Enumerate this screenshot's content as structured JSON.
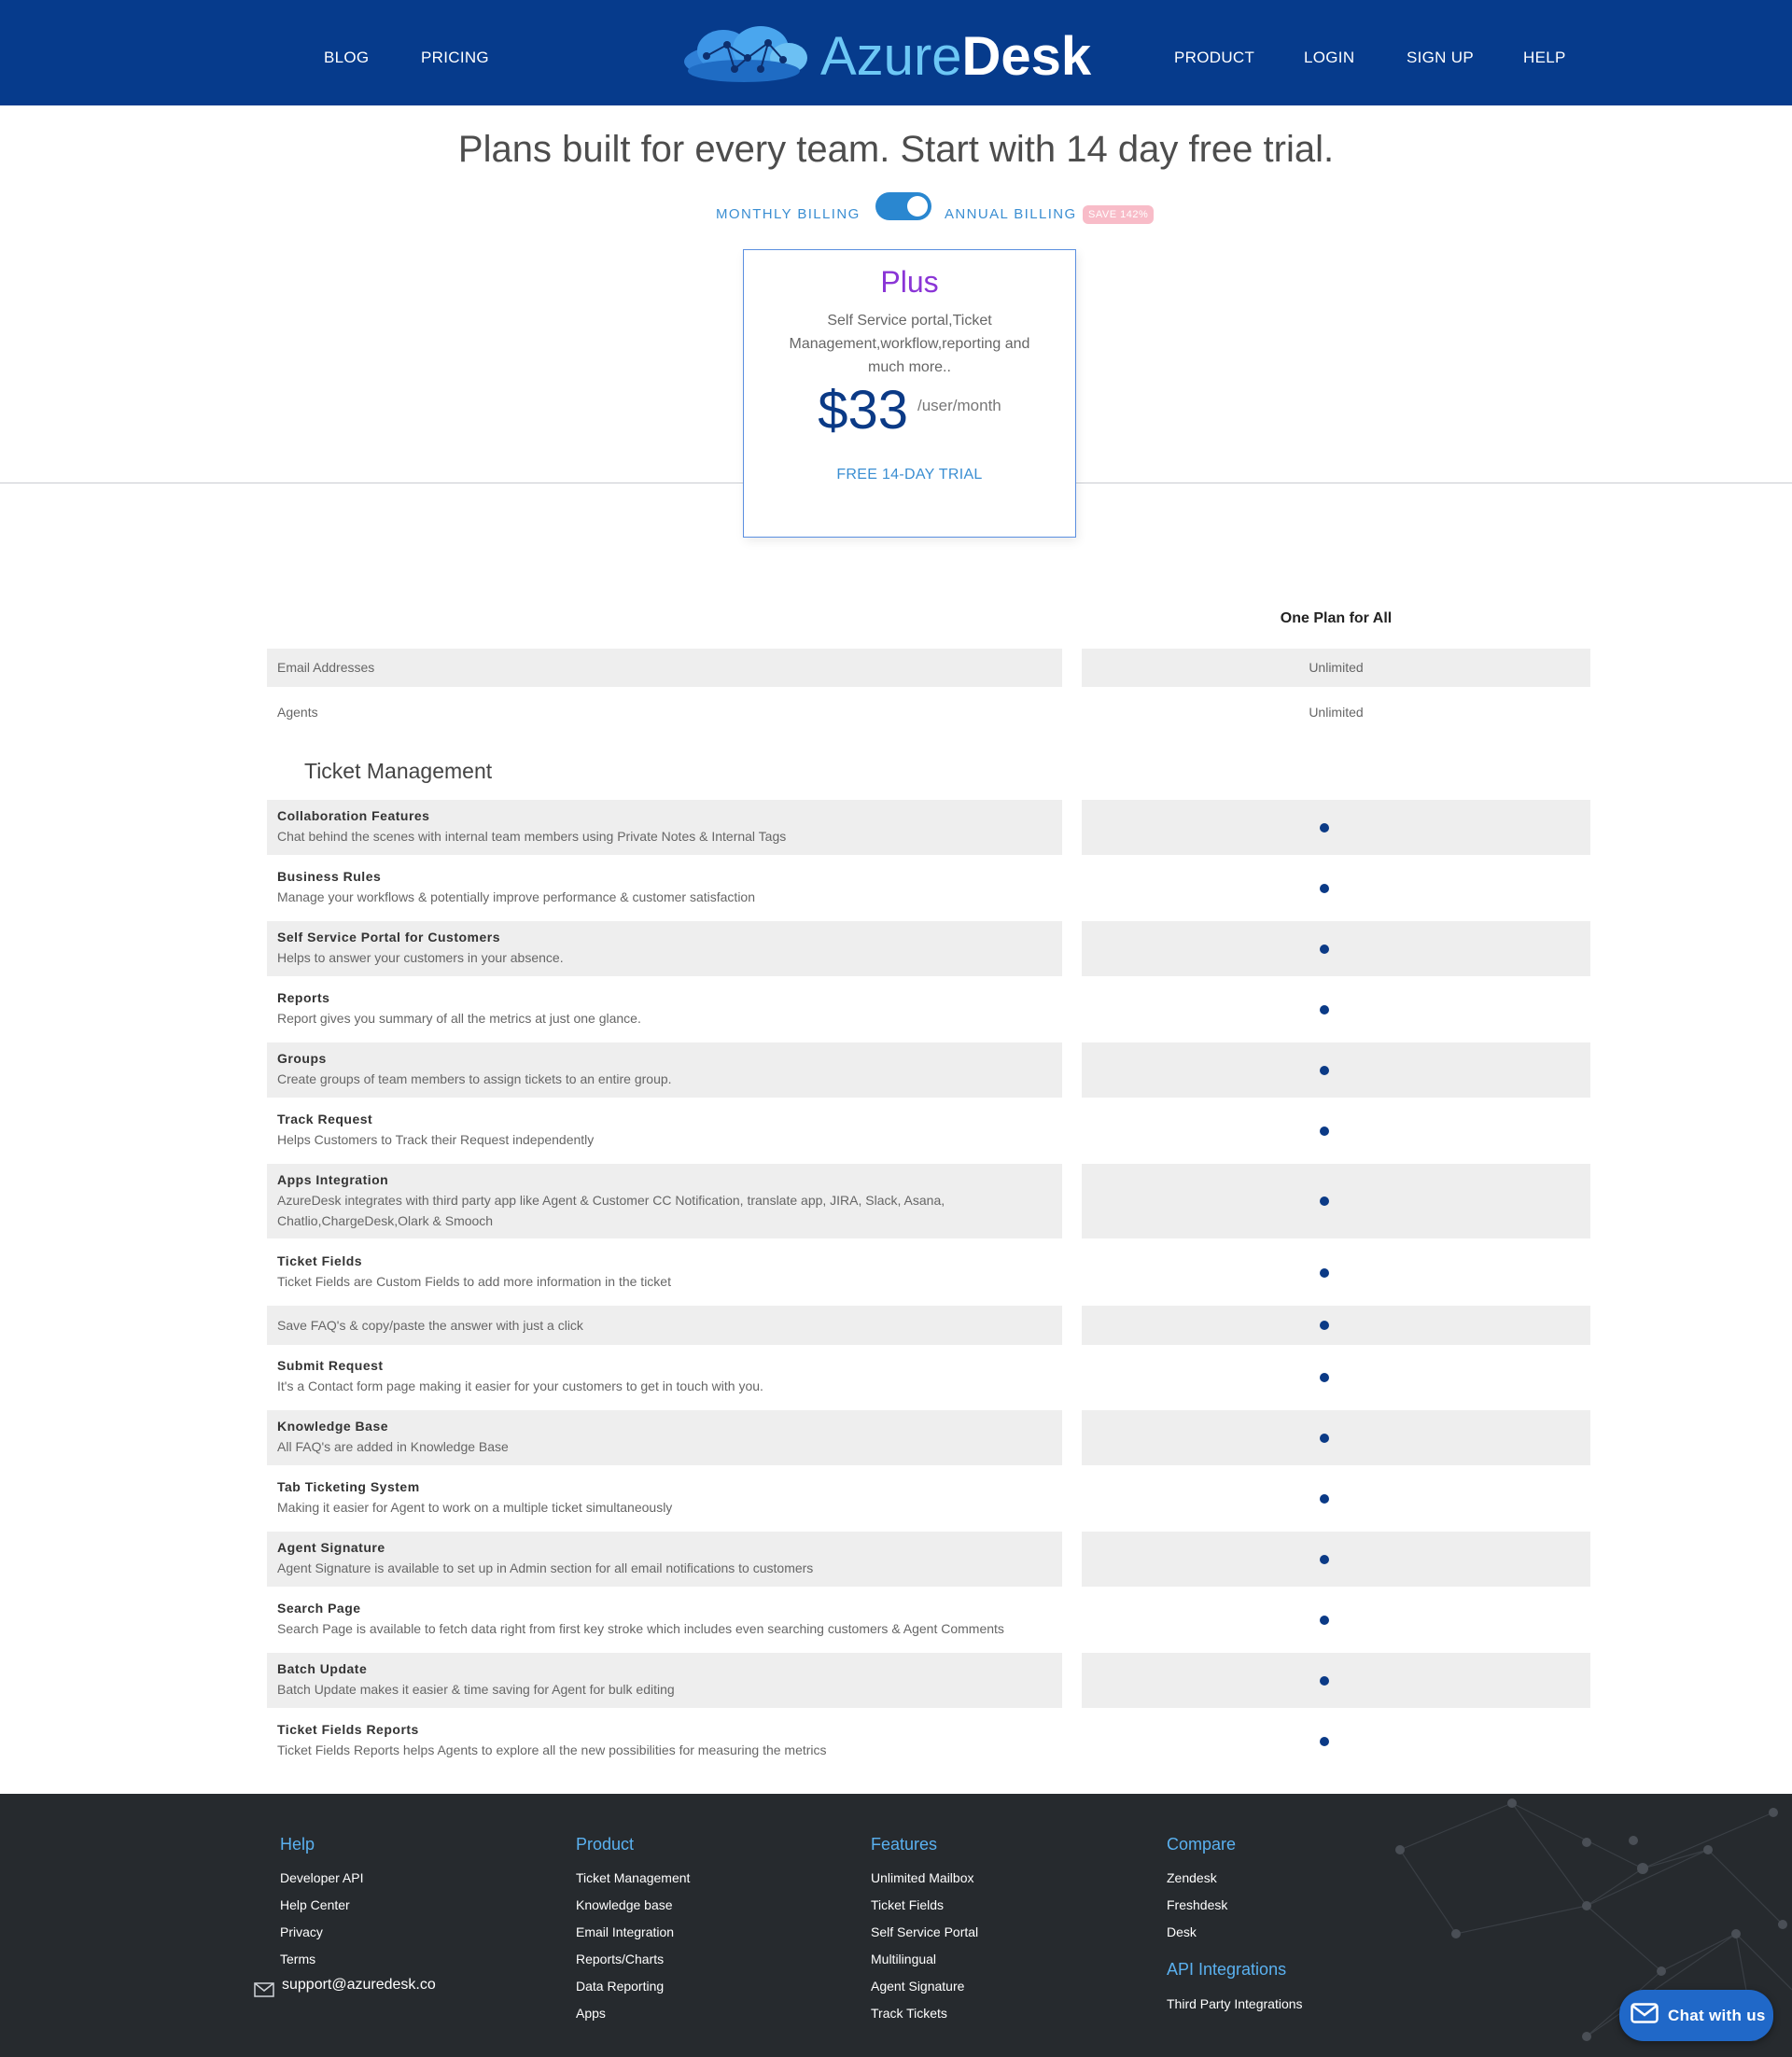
{
  "header": {
    "nav_left": [
      "BLOG",
      "PRICING"
    ],
    "logo": {
      "part1": "Azure",
      "part2": "Desk"
    },
    "nav_right": [
      "PRODUCT",
      "LOGIN",
      "SIGN UP",
      "HELP"
    ]
  },
  "hero": {
    "title": "Plans built for every team. Start with 14 day free trial.",
    "monthly_label": "MONTHLY BILLING",
    "annual_label": "ANNUAL BILLING",
    "save_badge": "SAVE 142%",
    "toggle_state": "annual"
  },
  "plan": {
    "name": "Plus",
    "description": "Self Service portal,Ticket Management,workflow,reporting and much more..",
    "price": "$33",
    "unit": "/user/month",
    "cta": "FREE 14-DAY TRIAL"
  },
  "table": {
    "column_header": "One Plan for All",
    "rows": [
      {
        "label": "Email Addresses",
        "value": "Unlimited"
      },
      {
        "label": "Agents",
        "value": "Unlimited"
      }
    ],
    "section_title": "Ticket Management",
    "features": [
      {
        "title": "Collaboration Features",
        "desc": "Chat behind the scenes with internal team members using Private Notes & Internal Tags"
      },
      {
        "title": "Business Rules",
        "desc": "Manage your workflows & potentially improve performance & customer satisfaction"
      },
      {
        "title": "Self Service Portal for Customers",
        "desc": "Helps to answer your customers in your absence."
      },
      {
        "title": "Reports",
        "desc": "Report gives you summary of all the metrics at just one glance."
      },
      {
        "title": "Groups",
        "desc": "Create groups of team members to assign tickets to an entire group."
      },
      {
        "title": "Track Request",
        "desc": "Helps Customers to Track their Request independently"
      },
      {
        "title": "Apps Integration",
        "desc": "AzureDesk integrates with third party app like Agent & Customer CC Notification, translate app, JIRA, Slack, Asana, Chatlio,ChargeDesk,Olark & Smooch"
      },
      {
        "title": "Ticket Fields",
        "desc": "Ticket Fields are Custom Fields to add more information in the ticket"
      },
      {
        "title": "",
        "desc": "Save FAQ's & copy/paste the answer with just a click"
      },
      {
        "title": "Submit Request",
        "desc": "It's a Contact form page making it easier for your customers to get in touch with you."
      },
      {
        "title": "Knowledge Base",
        "desc": "All FAQ's are added in Knowledge Base"
      },
      {
        "title": "Tab Ticketing System",
        "desc": "Making it easier for Agent to work on a multiple ticket simultaneously"
      },
      {
        "title": "Agent Signature",
        "desc": "Agent Signature is available to set up in Admin section for all email notifications to customers"
      },
      {
        "title": "Search Page",
        "desc": "Search Page is available to fetch data right from first key stroke which includes even searching customers & Agent Comments"
      },
      {
        "title": "Batch Update",
        "desc": "Batch Update makes it easier & time saving for Agent for bulk editing"
      },
      {
        "title": "Ticket Fields Reports",
        "desc": "Ticket Fields Reports helps Agents to explore all the new possibilities for measuring the metrics"
      }
    ]
  },
  "footer": {
    "help": {
      "heading": "Help",
      "links": [
        "Developer API",
        "Help Center",
        "Privacy",
        "Terms"
      ]
    },
    "email": "support@azuredesk.co",
    "product": {
      "heading": "Product",
      "links": [
        "Ticket Management",
        "Knowledge base",
        "Email Integration",
        "Reports/Charts",
        "Data Reporting",
        "Apps"
      ]
    },
    "features": {
      "heading": "Features",
      "links": [
        "Unlimited Mailbox",
        "Ticket Fields",
        "Self Service Portal",
        "Multilingual",
        "Agent Signature",
        "Track Tickets"
      ]
    },
    "compare": {
      "heading": "Compare",
      "links": [
        "Zendesk",
        "Freshdesk",
        "Desk"
      ]
    },
    "api": {
      "heading": "API Integrations",
      "links": [
        "Third Party Integrations"
      ]
    }
  },
  "chat": {
    "label": "Chat with us"
  },
  "colors": {
    "header_bg": "#063b8c",
    "accent": "#3a8ed2",
    "plan_name": "#8a35d6",
    "price": "#0b3a86",
    "footer_bg": "#262a2e",
    "footer_heading": "#5ab1f0",
    "chat_bg": "#2068c8"
  },
  "icons": {
    "logo": "cloud-network-icon",
    "toggle": "toggle-switch",
    "email": "envelope-icon",
    "chat": "envelope-icon",
    "included": "dot-icon"
  }
}
